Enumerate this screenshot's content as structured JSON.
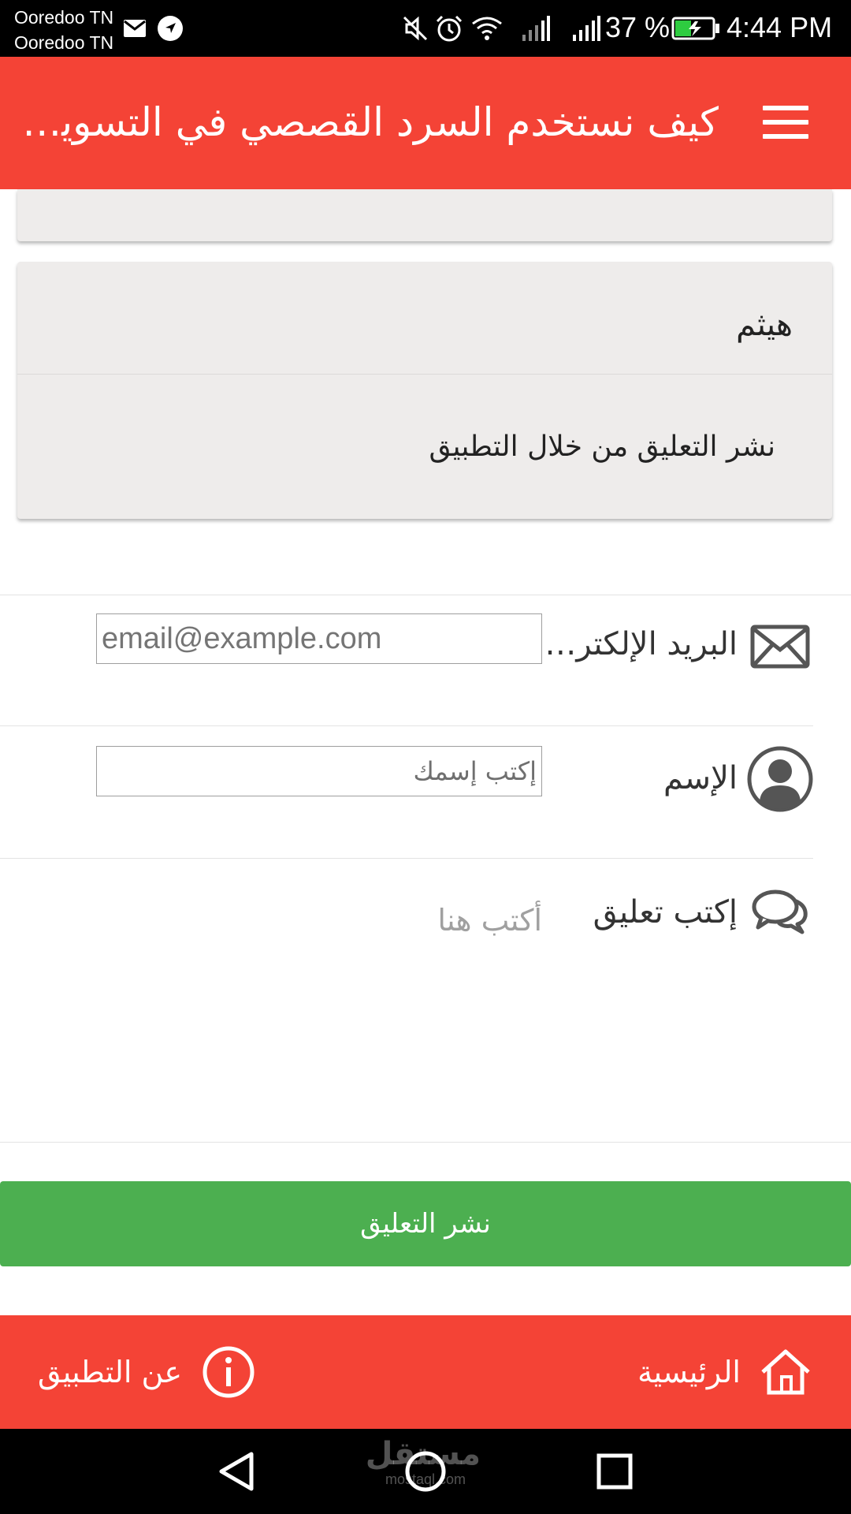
{
  "status_bar": {
    "carrier_1": "Ooredoo TN",
    "carrier_2": "Ooredoo TN",
    "battery": "37 %",
    "time": "4:44 PM",
    "icons": [
      "mail-icon",
      "navigation-icon",
      "mute-icon",
      "alarm-icon",
      "wifi-icon",
      "signal-icon",
      "signal-icon",
      "battery-charging-icon"
    ]
  },
  "header": {
    "title": "كيف نستخدم السرد القصصي في التسويق..",
    "menu_icon": "hamburger-menu-icon",
    "background": "#f44336"
  },
  "comments": [
    {
      "author": "هيثم",
      "text": "نشر التعليق من خلال التطبيق"
    }
  ],
  "form": {
    "email": {
      "label": "البريد الإلكتروني",
      "placeholder": "email@example.com",
      "icon": "envelope-icon"
    },
    "name": {
      "label": "الإسم",
      "placeholder": "إكتب إسمك",
      "icon": "user-avatar-icon"
    },
    "comment": {
      "label": "إكتب تعليق",
      "placeholder": "أكتب هنا",
      "icon": "chat-bubbles-icon"
    },
    "submit_label": "نشر التعليق",
    "submit_color": "#4caf50"
  },
  "bottom_bar": {
    "home_label": "الرئيسية",
    "home_icon": "home-icon",
    "about_label": "عن التطبيق",
    "about_icon": "info-icon"
  },
  "nav_bar": {
    "icons": [
      "back-icon",
      "home-circle-icon",
      "recents-icon"
    ]
  },
  "watermark": {
    "arabic": "مستقل",
    "latin": "mostaql.com"
  }
}
